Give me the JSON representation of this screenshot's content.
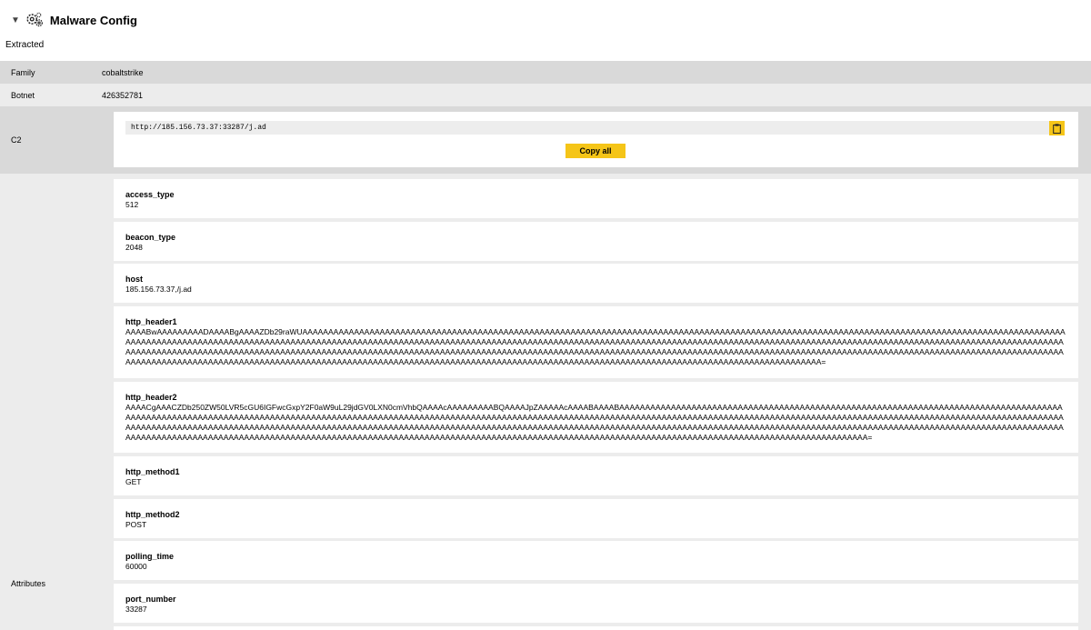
{
  "header": {
    "title": "Malware Config",
    "icon": "gears-icon"
  },
  "extracted_label": "Extracted",
  "family": {
    "label": "Family",
    "value": "cobaltstrike"
  },
  "botnet": {
    "label": "Botnet",
    "value": "426352781"
  },
  "c2": {
    "label": "C2",
    "url": "http://185.156.73.37:33287/j.ad",
    "copy_all": "Copy all"
  },
  "attributes": {
    "label": "Attributes",
    "items": [
      {
        "key": "access_type",
        "value": "512"
      },
      {
        "key": "beacon_type",
        "value": "2048"
      },
      {
        "key": "host",
        "value": "185.156.73.37,/j.ad"
      },
      {
        "key": "http_header1",
        "value": "AAAABwAAAAAAAAADAAAABgAAAAZDb29raWUAAAAAAAAAAAAAAAAAAAAAAAAAAAAAAAAAAAAAAAAAAAAAAAAAAAAAAAAAAAAAAAAAAAAAAAAAAAAAAAAAAAAAAAAAAAAAAAAAAAAAAAAAAAAAAAAAAAAAAAAAAAAAAAAAAAAAAAAAAAAAAAAAAAAAAAAAAAAAAAAAAAAAAAAAAAAAAAAAAAAAAAAAAAAAAAAAAAAAAAAAAAAAAAAAAAAAAAAAAAAAAAAAAAAAAAAAAAAAAAAAAAAAAAAAAAAAAAAAAAAAAAAAAAAAAAAAAAAAAAAAAAAAAAAAAAAAAAAAAAAAAAAAAAAAAAAAAAAAAAAAAAAAAAAAAAAAAAAAAAAAAAAAAAAAAAAAAAAAAAAAAAAAAAAAAAAAAAAAAAAAAAAAAAAAAAAAAAAAAAAAAAAAAAAAAAAAAAAAAAAAAAAAAAAAAAAAAAAAAAAAAAAAAAAAAAAAAAAAAAAAAAAAAAAAAAAAAAAAAAAAAAAAAAAAAAAAAAAAAAAAAAAAAAAAAAAAAAAAAAAAAAAAAAAAAAAAAAAAAAAAAAAAAAAAAAAAAAAAAAAAAAAAAAAAAAAAAAAAAAAAAAAAAAAAAAAAAAAAAAAAAAAAAAAAAAAAAAAAAAAAAAAAAAAAAAAAAAAAAAAAAAAAAA="
      },
      {
        "key": "http_header2",
        "value": "AAAACgAAACZDb250ZW50LVR5cGU6IGFwcGxpY2F0aW9uL29jdGV0LXN0cmVhbQAAAAcAAAAAAAAABQAAAAJpZAAAAAcAAAABAAAABAAAAAAAAAAAAAAAAAAAAAAAAAAAAAAAAAAAAAAAAAAAAAAAAAAAAAAAAAAAAAAAAAAAAAAAAAAAAAAAAAAAAAAAAAAAAAAAAAAAAAAAAAAAAAAAAAAAAAAAAAAAAAAAAAAAAAAAAAAAAAAAAAAAAAAAAAAAAAAAAAAAAAAAAAAAAAAAAAAAAAAAAAAAAAAAAAAAAAAAAAAAAAAAAAAAAAAAAAAAAAAAAAAAAAAAAAAAAAAAAAAAAAAAAAAAAAAAAAAAAAAAAAAAAAAAAAAAAAAAAAAAAAAAAAAAAAAAAAAAAAAAAAAAAAAAAAAAAAAAAAAAAAAAAAAAAAAAAAAAAAAAAAAAAAAAAAAAAAAAAAAAAAAAAAAAAAAAAAAAAAAAAAAAAAAAAAAAAAAAAAAAAAAAAAAAAAAAAAAAAAAAAAAAAAAAAAAAAAAAAAAAAAAAAAAAAAAAAAAAAAAAAAAAAAAAAAAAAAAAAAAAAAAAAAAAAAAAAAAAAAAAAAAAAAAAAAAAAAAAAAAAAAAAAAAAAAAAAAAAAAAAAAAAAAAAAAAAAAAAAAAAAAAAAAAAAAAAAAAAAAAAAAAAAAAAAAA="
      },
      {
        "key": "http_method1",
        "value": "GET"
      },
      {
        "key": "http_method2",
        "value": "POST"
      },
      {
        "key": "polling_time",
        "value": "60000"
      },
      {
        "key": "port_number",
        "value": "33287"
      }
    ]
  },
  "colors": {
    "accent": "#f5c518",
    "label_bg": "#d9d9d9",
    "alt_bg": "#ececec"
  }
}
